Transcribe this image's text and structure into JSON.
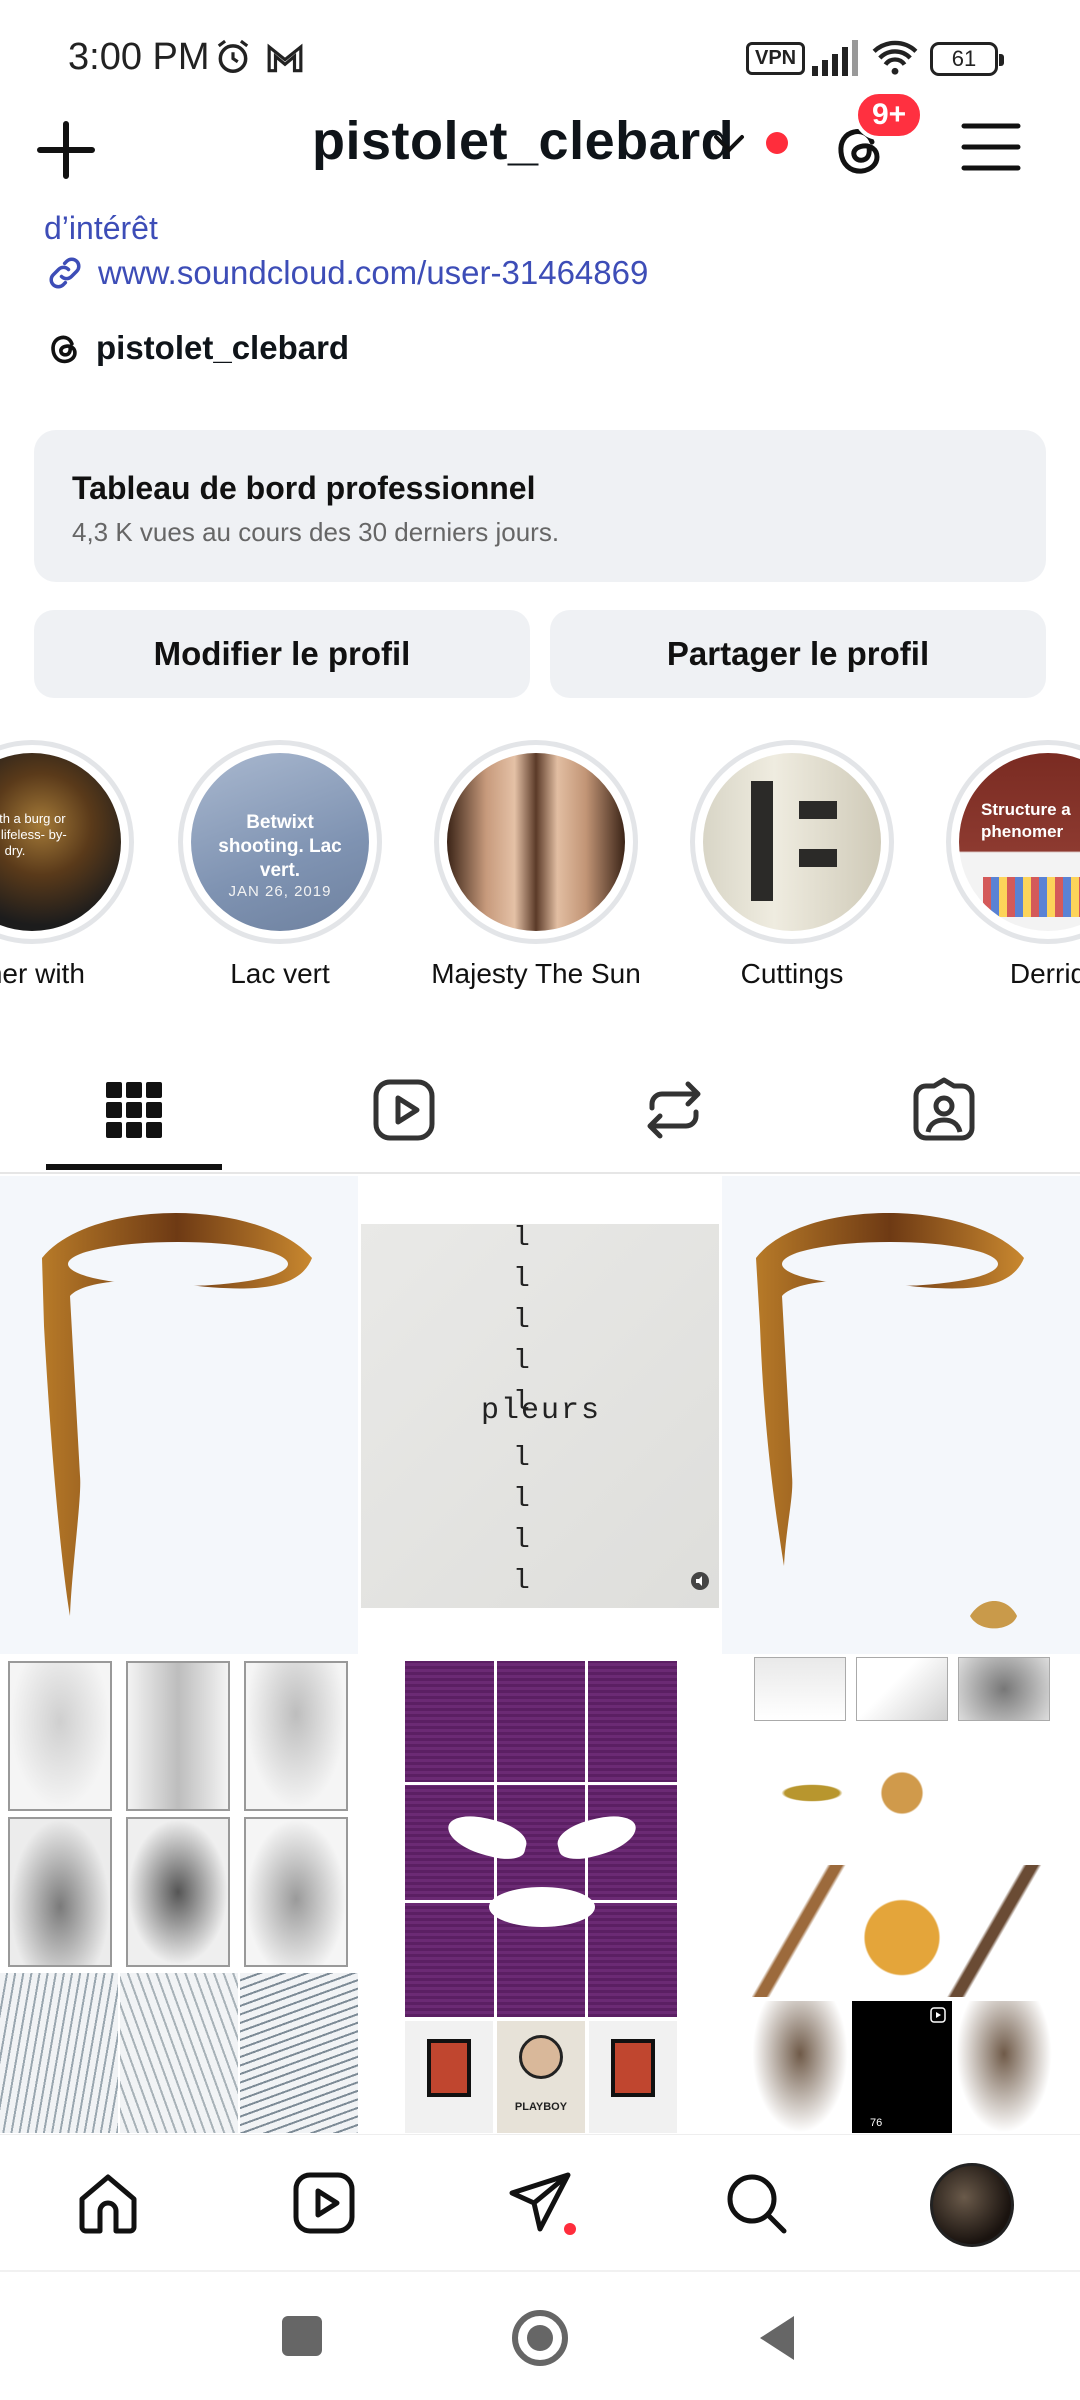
{
  "status_bar": {
    "time": "3:00 PM",
    "vpn": "VPN",
    "battery": "61"
  },
  "header": {
    "username": "pistolet_clebard",
    "notifications_badge": "9+"
  },
  "bio": {
    "text_fragment": "d’intérêt",
    "link": "www.soundcloud.com/user-31464869",
    "threads_handle": "pistolet_clebard"
  },
  "dashboard": {
    "title": "Tableau de bord professionnel",
    "subtitle": "4,3 K vues au cours des 30 derniers jours."
  },
  "buttons": {
    "edit_profile": "Modifier le profil",
    "share_profile": "Partager le profil"
  },
  "highlights": [
    {
      "label": "ther with",
      "cover_text": "per with a burg or ...lling lifeless- by-dry."
    },
    {
      "label": "Lac vert",
      "cover_text": "Betwixt shooting. Lac vert.",
      "cover_date": "JAN 26, 2019"
    },
    {
      "label": "Majesty The Sun"
    },
    {
      "label": "Cuttings"
    },
    {
      "label": "Derrid",
      "cover_text": "Structure a phenomer"
    }
  ],
  "posts": {
    "typewriter_word": "pleurs",
    "playboy_text": "PLAYBOY",
    "reel_views": "76"
  },
  "colors": {
    "accent_link": "#3d4db7",
    "badge_red": "#ff3040",
    "button_bg": "#eff1f4"
  },
  "icons": {
    "header": [
      "plus-icon",
      "chevron-down-icon",
      "threads-icon",
      "hamburger-menu-icon"
    ],
    "tabs": [
      "grid-icon",
      "reels-icon",
      "reposts-icon",
      "tagged-icon"
    ],
    "bottom_nav": [
      "home-icon",
      "reels-icon",
      "direct-message-icon",
      "search-icon",
      "profile-avatar"
    ]
  }
}
